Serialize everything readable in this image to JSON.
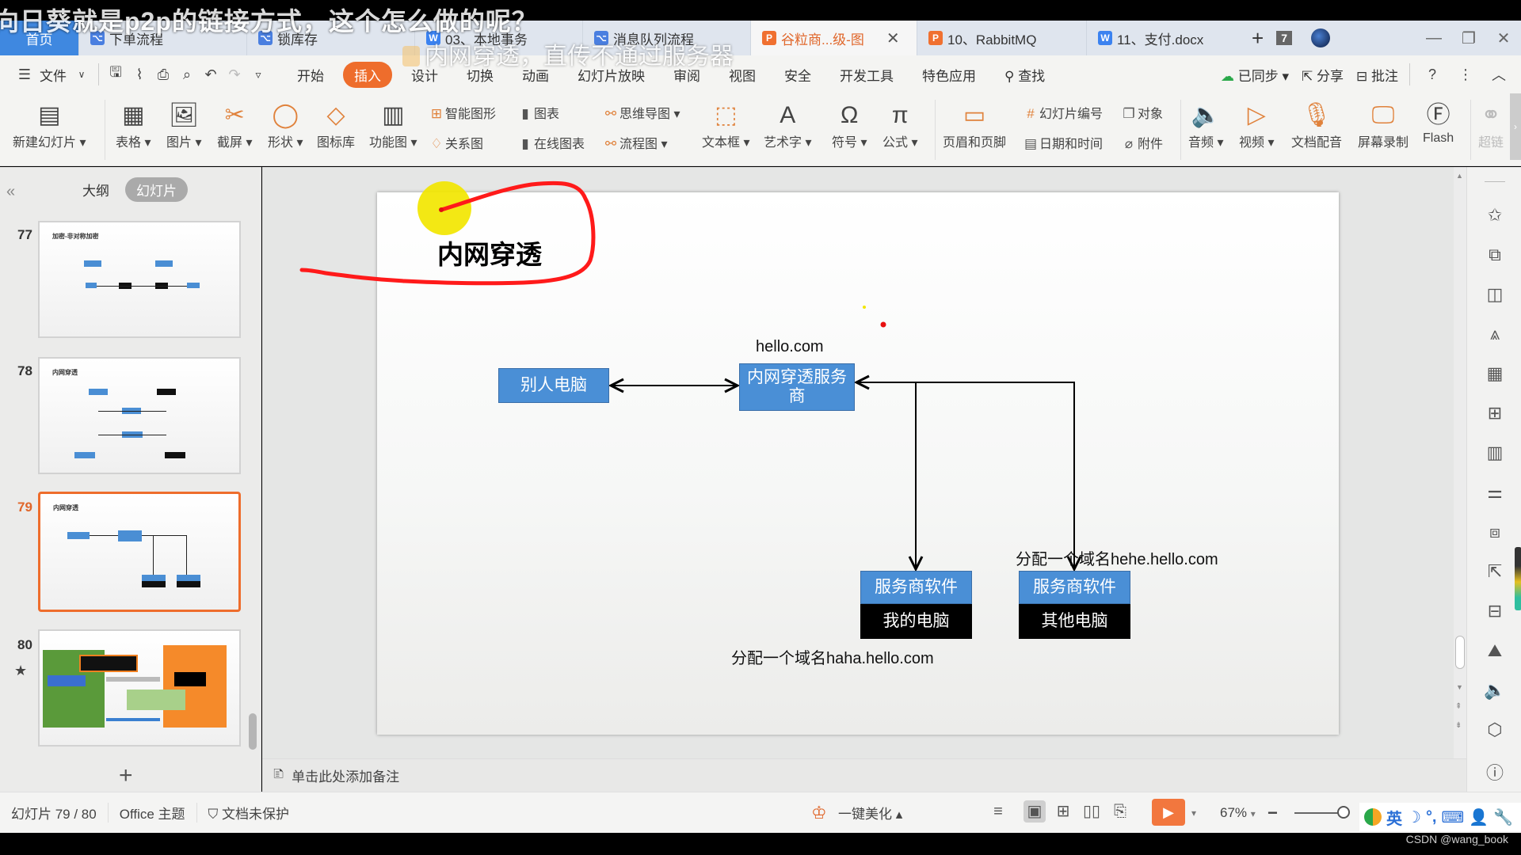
{
  "overlay": {
    "caption_top": "向日葵就是p2p的链接方式，这个怎么做的呢？",
    "caption_mid": "内网穿透，直传不通过服务器"
  },
  "tabs": [
    {
      "label": "首页",
      "icon": "home"
    },
    {
      "label": "下单流程",
      "icon": "flowchart-icon"
    },
    {
      "label": "锁库存",
      "icon": "flowchart-icon"
    },
    {
      "label": "03、本地事务",
      "icon": "word-icon"
    },
    {
      "label": "消息队列流程",
      "icon": "flowchart-icon"
    },
    {
      "label": "谷粒商...级-图",
      "icon": "ppt-icon",
      "active": true
    },
    {
      "label": "10、RabbitMQ",
      "icon": "ppt-icon"
    },
    {
      "label": "11、支付.docx",
      "icon": "word-icon"
    }
  ],
  "tabbar_extra": {
    "new_tab": "+",
    "tab_count": "7"
  },
  "window_controls": {
    "minimize": "—",
    "restore": "❐",
    "close": "✕"
  },
  "menu": {
    "file": "文件",
    "items": [
      "开始",
      "插入",
      "设计",
      "切换",
      "动画",
      "幻灯片放映",
      "审阅",
      "视图",
      "安全",
      "开发工具",
      "特色应用"
    ],
    "active": "插入",
    "search": "查找",
    "sync": "已同步",
    "share": "分享",
    "comment": "批注"
  },
  "ribbon": {
    "new_slide": "新建幻灯片",
    "table": "表格",
    "picture": "图片",
    "screenshot": "截屏",
    "shape": "形状",
    "icon_lib": "图标库",
    "function_chart": "功能图",
    "smart_art": "智能图形",
    "chart": "图表",
    "relation": "关系图",
    "online_chart": "在线图表",
    "mind_map": "思维导图",
    "flowchart": "流程图",
    "textbox": "文本框",
    "wordart": "艺术字",
    "symbol": "符号",
    "formula": "公式",
    "header_footer": "页眉和页脚",
    "slide_number": "幻灯片编号",
    "object": "对象",
    "date_time": "日期和时间",
    "attachment": "附件",
    "audio": "音频",
    "video": "视频",
    "doc_dub": "文档配音",
    "screen_record": "屏幕录制",
    "flash": "Flash",
    "hyperlink": "超链"
  },
  "left_panel": {
    "tab_outline": "大纲",
    "tab_slides": "幻灯片",
    "slides": [
      {
        "num": "77",
        "title": "加密-非对称加密"
      },
      {
        "num": "78",
        "title": "内网穿透"
      },
      {
        "num": "79",
        "title": "内网穿透",
        "current": true
      },
      {
        "num": "80",
        "title": ""
      }
    ],
    "add": "+"
  },
  "slide": {
    "title": "内网穿透",
    "domain_label": "hello.com",
    "box_other_pc": "别人电脑",
    "box_provider": "内网穿透服务商",
    "box_sw1": "服务商软件",
    "box_my_pc": "我的电脑",
    "box_sw2": "服务商软件",
    "box_other_pc2": "其他电脑",
    "assign_hehe": "分配一个域名hehe.hello.com",
    "assign_haha": "分配一个域名haha.hello.com"
  },
  "notes": {
    "placeholder": "单击此处添加备注"
  },
  "status": {
    "slide_counter": "幻灯片 79 / 80",
    "theme": "Office 主题",
    "protection": "文档未保护",
    "beautify": "一键美化",
    "zoom": "67%"
  },
  "ime": {
    "lang": "英"
  },
  "watermark": "CSDN @wang_book",
  "colors": {
    "accent": "#ee6d2c",
    "box_blue": "#4a8fd6",
    "annotation_red": "#ff1a1a",
    "highlight_yellow": "#f2e600"
  }
}
